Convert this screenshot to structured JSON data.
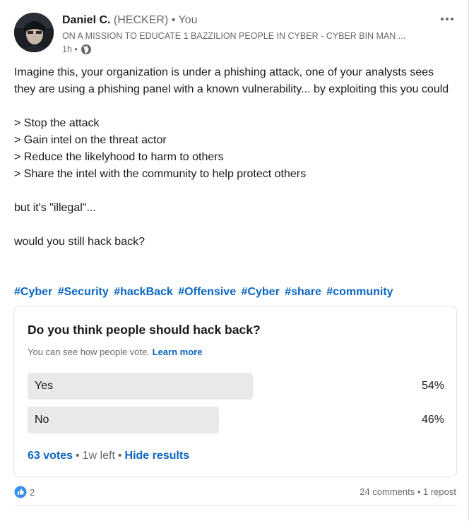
{
  "post": {
    "author_name": "Daniel C.",
    "author_pronoun_tag": "(HECKER)",
    "author_relation": "• You",
    "headline": "ON A MISSION TO EDUCATE 1 BAZZILION PEOPLE IN CYBER - CYBER BIN MAN ...",
    "time": "1h •",
    "visibility_icon": "globe-icon",
    "paragraphs": [
      "Imagine this, your organization is under a phishing attack, one of your analysts sees they are using a phishing panel with a known vulnerability... by exploiting this you could",
      "> Stop the attack",
      "> Gain intel on the threat actor",
      "> Reduce the likelyhood to harm to others",
      "> Share the intel with the community to help protect others",
      "but it's \"illegal\"...",
      "would you still hack back?"
    ],
    "hashtags": [
      "#Cyber",
      "#Security",
      "#hackBack",
      "#Offensive",
      "#Cyber",
      "#share",
      "#community"
    ]
  },
  "poll": {
    "question": "Do you think people should hack back?",
    "note": "You can see how people vote.",
    "learn_more": "Learn more",
    "options": [
      {
        "label": "Yes",
        "percent_text": "54%",
        "fraction": 0.54
      },
      {
        "label": "No",
        "percent_text": "46%",
        "fraction": 0.46
      }
    ],
    "votes": "63 votes",
    "time_left": "1w left",
    "hide_results": "Hide results"
  },
  "social": {
    "reaction_count": "2",
    "comments_reposts": "24 comments • 1 repost"
  },
  "colors": {
    "link": "#0a66c2",
    "bar": "#e9e9e9"
  }
}
